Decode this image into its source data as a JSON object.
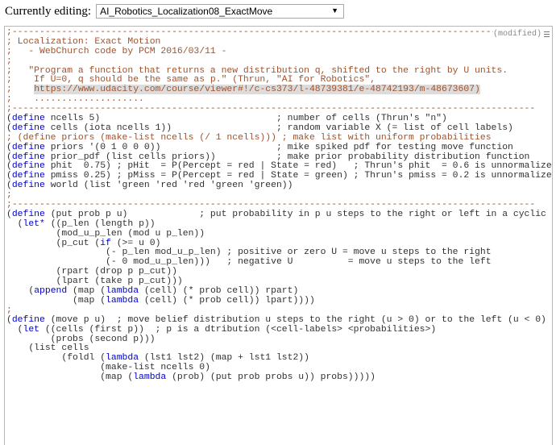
{
  "top": {
    "label": "Currently editing:",
    "selected_file": "AI_Robotics_Localization08_ExactMove"
  },
  "editor": {
    "status": "(modified)",
    "lines": [
      [
        {
          "t": "cm",
          "s": ";-----------------------------------------------------------------------------------------------"
        }
      ],
      [
        {
          "t": "cm",
          "s": "; Localization: Exact Motion"
        }
      ],
      [
        {
          "t": "cm",
          "s": ";   - WebChurch code by PCM 2016/03/11 -"
        }
      ],
      [
        {
          "t": "cm",
          "s": ";"
        }
      ],
      [
        {
          "t": "cm",
          "s": ";   \"Program a function that returns a new distribution q, shifted to the right by U units."
        }
      ],
      [
        {
          "t": "cm",
          "s": ";    If U=0, q should be the same as p.\" (Thrun, \"AI for Robotics\","
        }
      ],
      [
        {
          "t": "cm",
          "s": ";    "
        },
        {
          "t": "url",
          "s": "https://www.udacity.com/course/viewer#!/c-cs373/l-48739381/e-48742193/m-48673607)"
        }
      ],
      [
        {
          "t": "cm",
          "s": ";    ...................."
        }
      ],
      [
        {
          "t": "cm",
          "s": ";-----------------------------------------------------------------------------------------------"
        }
      ],
      [
        {
          "t": "tx",
          "s": "("
        },
        {
          "t": "kw",
          "s": "define"
        },
        {
          "t": "tx",
          "s": " ncells 5)                                ; number of cells (Thrun's \"n\")"
        }
      ],
      [
        {
          "t": "tx",
          "s": "("
        },
        {
          "t": "kw",
          "s": "define"
        },
        {
          "t": "tx",
          "s": " cells (iota ncells 1))                   ; random variable X (= list of cell labels)"
        }
      ],
      [
        {
          "t": "cm",
          "s": "; (define priors (make-list ncells (/ 1 ncells))) ; make list with uniform probabilities"
        }
      ],
      [
        {
          "t": "tx",
          "s": "("
        },
        {
          "t": "kw",
          "s": "define"
        },
        {
          "t": "tx",
          "s": " priors '(0 1 0 0 0))                     ; mike spiked pdf for testing move function"
        }
      ],
      [
        {
          "t": "tx",
          "s": "("
        },
        {
          "t": "kw",
          "s": "define"
        },
        {
          "t": "tx",
          "s": " prior_pdf (list cells priors))           ; make prior probability distribution function"
        }
      ],
      [
        {
          "t": "tx",
          "s": "("
        },
        {
          "t": "kw",
          "s": "define"
        },
        {
          "t": "tx",
          "s": " phit  0.75) ; pHit  = P(Percept = red | State = red)   ; Thrun's phit  = 0.6 is unnormalized !"
        }
      ],
      [
        {
          "t": "tx",
          "s": "("
        },
        {
          "t": "kw",
          "s": "define"
        },
        {
          "t": "tx",
          "s": " pmiss 0.25) ; pMiss = P(Percept = red | State = green) ; Thrun's pmiss = 0.2 is unnormalized !"
        }
      ],
      [
        {
          "t": "tx",
          "s": "("
        },
        {
          "t": "kw",
          "s": "define"
        },
        {
          "t": "tx",
          "s": " world (list 'green 'red 'red 'green 'green))"
        }
      ],
      [
        {
          "t": "cm",
          "s": ";"
        }
      ],
      [
        {
          "t": "cm",
          "s": ";-----------------------------------------------------------------------------------------------"
        }
      ],
      [
        {
          "t": "tx",
          "s": "("
        },
        {
          "t": "kw",
          "s": "define"
        },
        {
          "t": "tx",
          "s": " (put prob p u)             ; put probability in p u steps to the right or left in a cyclic world"
        }
      ],
      [
        {
          "t": "tx",
          "s": "  ("
        },
        {
          "t": "kw",
          "s": "let*"
        },
        {
          "t": "tx",
          "s": " ((p_len (length p))"
        }
      ],
      [
        {
          "t": "tx",
          "s": "         (mod_u_p_len (mod u p_len))"
        }
      ],
      [
        {
          "t": "tx",
          "s": "         (p_cut ("
        },
        {
          "t": "kw",
          "s": "if"
        },
        {
          "t": "tx",
          "s": " (>= u 0)"
        }
      ],
      [
        {
          "t": "tx",
          "s": "                  (- p_len mod_u_p_len) ; positive or zero U = move u steps to the right"
        }
      ],
      [
        {
          "t": "tx",
          "s": "                  (- 0 mod_u_p_len)))   ; negative U          = move u steps to the left"
        }
      ],
      [
        {
          "t": "tx",
          "s": "         (rpart (drop p p_cut))"
        }
      ],
      [
        {
          "t": "tx",
          "s": "         (lpart (take p p_cut)))"
        }
      ],
      [
        {
          "t": "tx",
          "s": "    ("
        },
        {
          "t": "kw",
          "s": "append"
        },
        {
          "t": "tx",
          "s": " (map ("
        },
        {
          "t": "kw",
          "s": "lambda"
        },
        {
          "t": "tx",
          "s": " (cell) (* prob cell)) rpart)"
        }
      ],
      [
        {
          "t": "tx",
          "s": "            (map ("
        },
        {
          "t": "kw",
          "s": "lambda"
        },
        {
          "t": "tx",
          "s": " (cell) (* prob cell)) lpart))))"
        }
      ],
      [
        {
          "t": "cm",
          "s": ";"
        }
      ],
      [
        {
          "t": "tx",
          "s": "("
        },
        {
          "t": "kw",
          "s": "define"
        },
        {
          "t": "tx",
          "s": " (move p u)  ; move belief distribution u steps to the right (u > 0) or to the left (u < 0) or stay"
        }
      ],
      [
        {
          "t": "tx",
          "s": "  ("
        },
        {
          "t": "kw",
          "s": "let"
        },
        {
          "t": "tx",
          "s": " ((cells (first p))  ; p is a dtribution (<cell-labels> <probabilities>)"
        }
      ],
      [
        {
          "t": "tx",
          "s": "        (probs (second p)))"
        }
      ],
      [
        {
          "t": "tx",
          "s": "    (list cells"
        }
      ],
      [
        {
          "t": "tx",
          "s": "          (foldl ("
        },
        {
          "t": "kw",
          "s": "lambda"
        },
        {
          "t": "tx",
          "s": " (lst1 lst2) (map + lst1 lst2))"
        }
      ],
      [
        {
          "t": "tx",
          "s": "                 (make-list ncells 0)"
        }
      ],
      [
        {
          "t": "tx",
          "s": "                 (map ("
        },
        {
          "t": "kw",
          "s": "lambda"
        },
        {
          "t": "tx",
          "s": " (prob) (put prob probs u)) probs)))))"
        }
      ],
      [
        {
          "t": "tx",
          "s": ""
        }
      ]
    ]
  }
}
